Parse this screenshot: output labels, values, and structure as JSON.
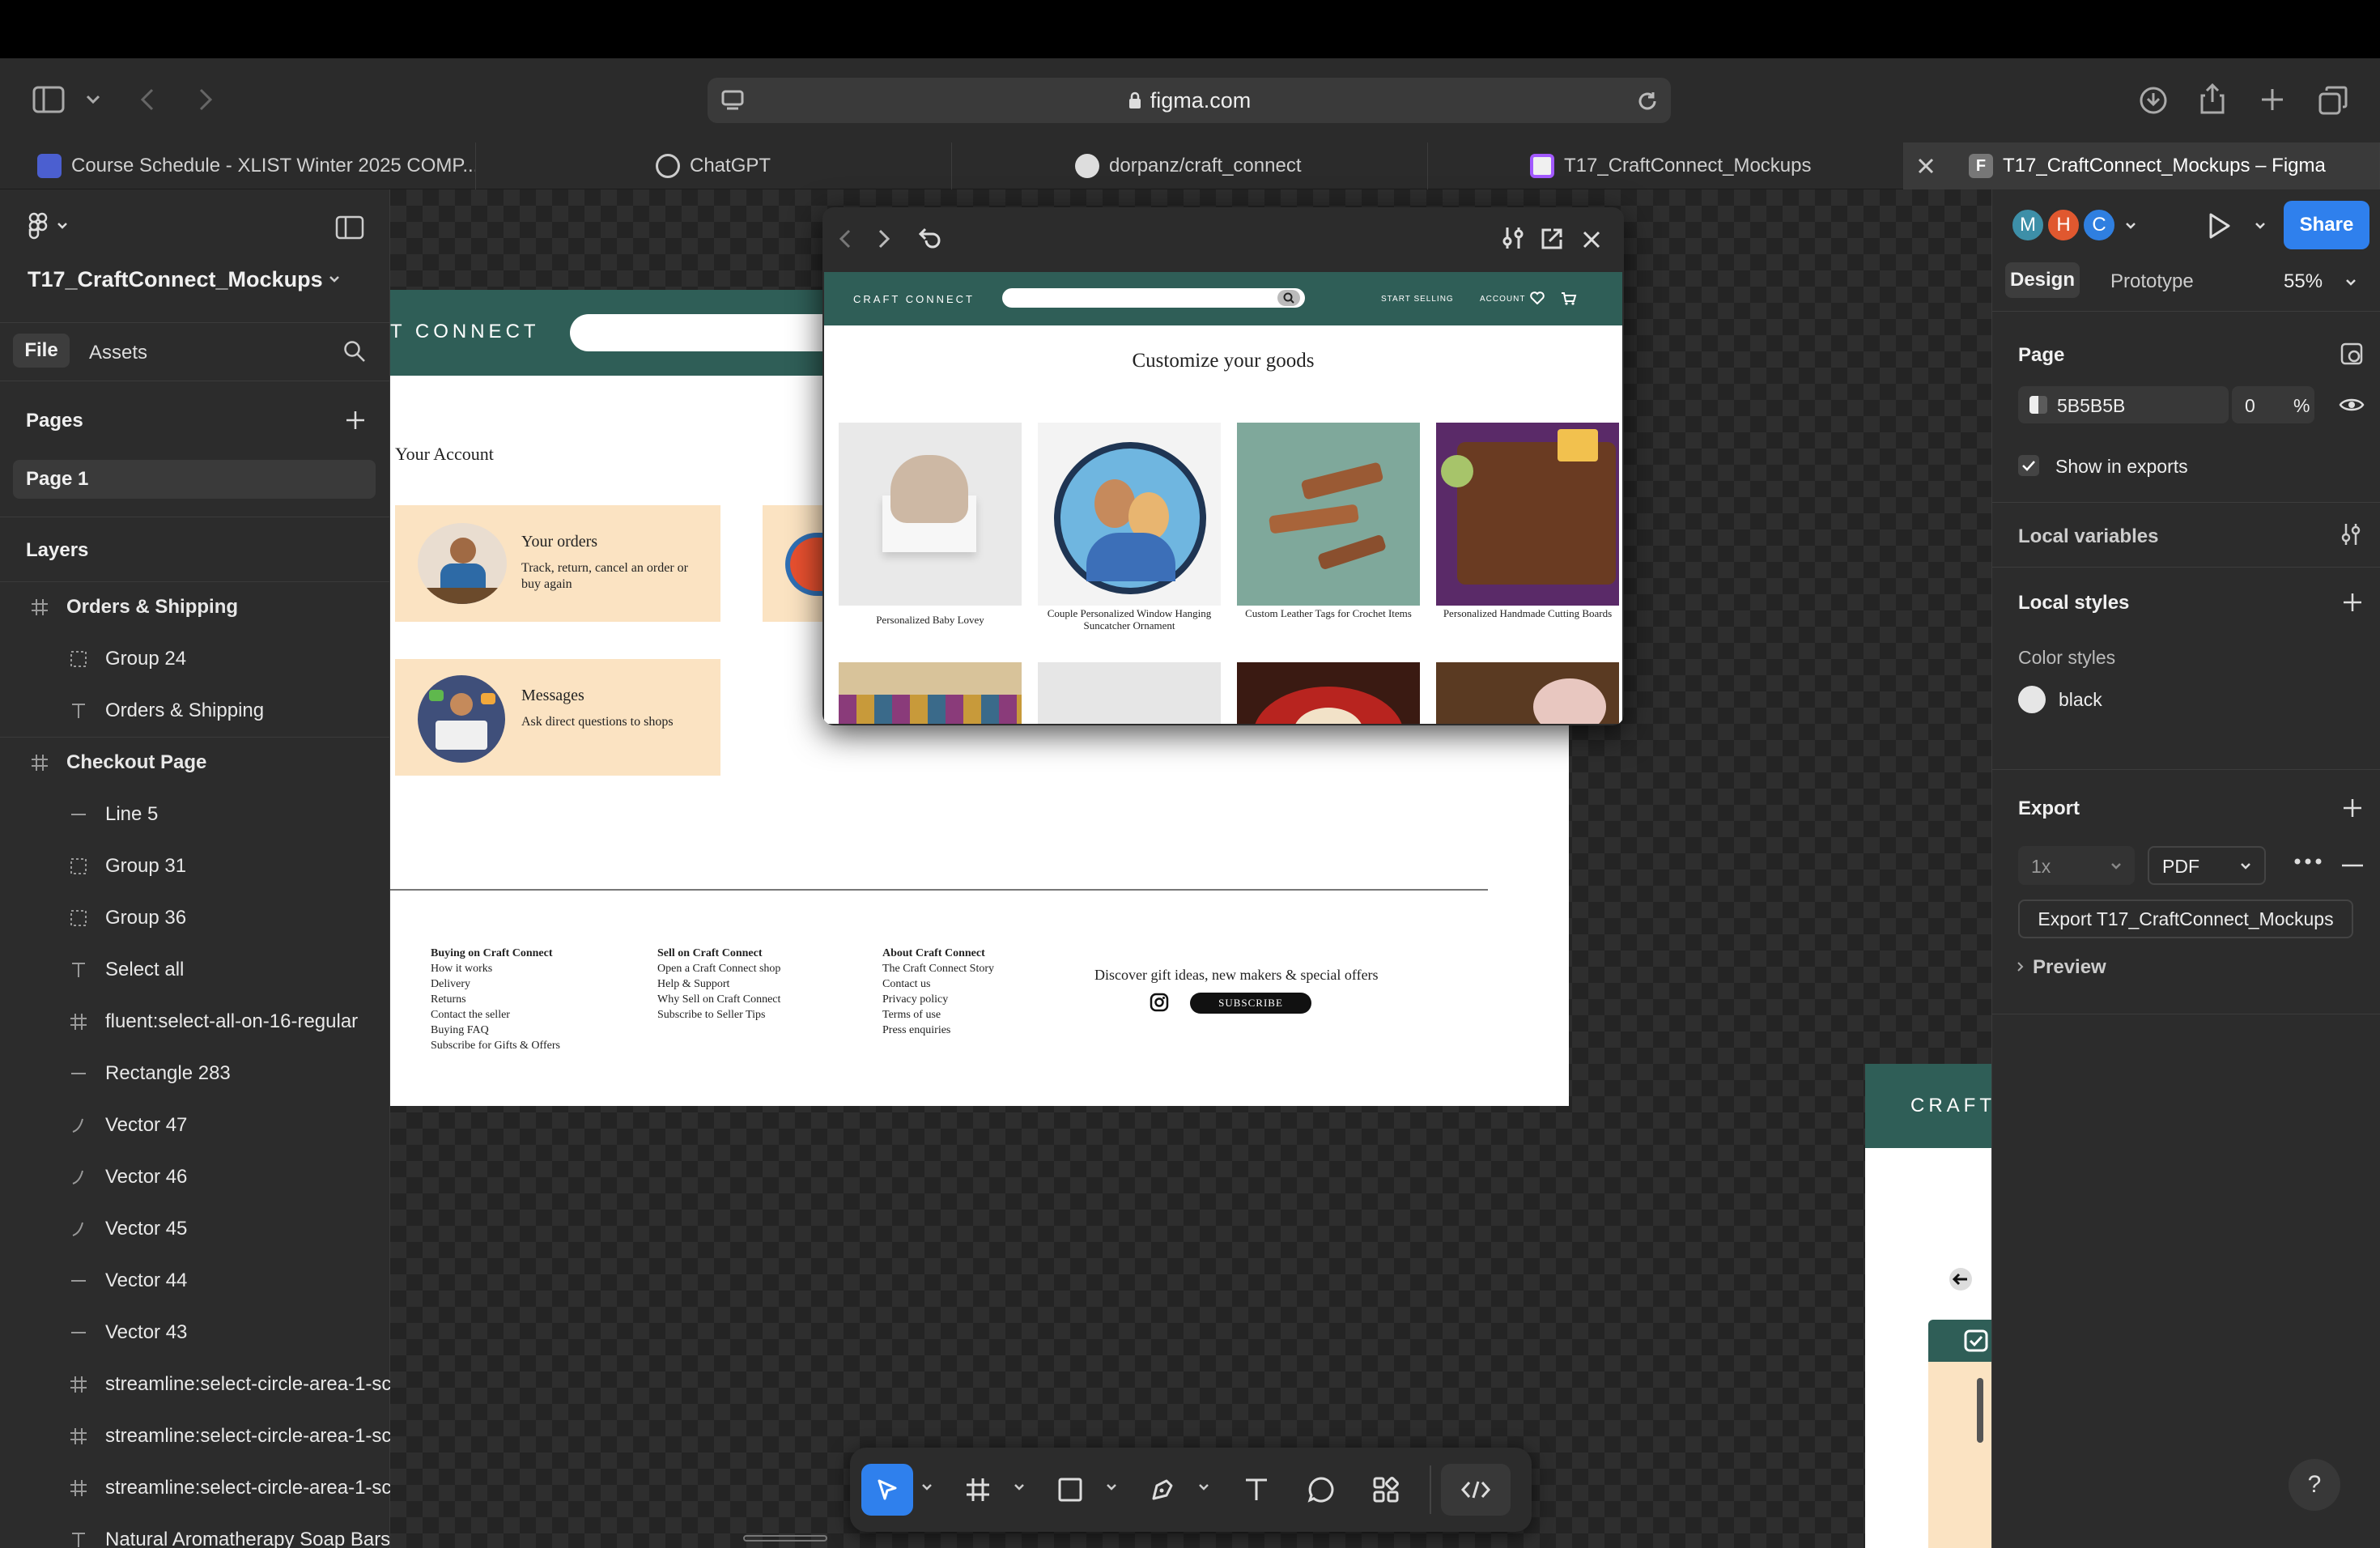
{
  "browser": {
    "url": "figma.com",
    "tabs": [
      {
        "label": "Course Schedule - XLIST Winter 2025 COMP..."
      },
      {
        "label": "ChatGPT"
      },
      {
        "label": "dorpanz/craft_connect"
      },
      {
        "label": "T17_CraftConnect_Mockups"
      },
      {
        "label": "T17_CraftConnect_Mockups – Figma"
      }
    ]
  },
  "left_panel": {
    "file_name": "T17_CraftConnect_Mockups",
    "tab_file": "File",
    "tab_assets": "Assets",
    "pages_title": "Pages",
    "page_1": "Page 1",
    "layers_title": "Layers",
    "layers": [
      {
        "name": "Orders & Shipping",
        "icon": "frame-icon",
        "bold": true
      },
      {
        "name": "Group 24",
        "icon": "group-icon"
      },
      {
        "name": "Orders & Shipping",
        "icon": "text-icon"
      },
      {
        "name": "Checkout Page",
        "icon": "frame-icon",
        "bold": true
      },
      {
        "name": "Line 5",
        "icon": "line-icon"
      },
      {
        "name": "Group 31",
        "icon": "group-icon"
      },
      {
        "name": "Group 36",
        "icon": "group-icon"
      },
      {
        "name": "Select all",
        "icon": "text-icon"
      },
      {
        "name": "fluent:select-all-on-16-regular",
        "icon": "frame-icon"
      },
      {
        "name": "Rectangle 283",
        "icon": "line-icon"
      },
      {
        "name": "Vector 47",
        "icon": "vector-icon"
      },
      {
        "name": "Vector 46",
        "icon": "vector-icon"
      },
      {
        "name": "Vector 45",
        "icon": "vector-icon"
      },
      {
        "name": "Vector 44",
        "icon": "line-icon"
      },
      {
        "name": "Vector 43",
        "icon": "line-icon"
      },
      {
        "name": "streamline:select-circle-area-1-sc",
        "icon": "frame-icon"
      },
      {
        "name": "streamline:select-circle-area-1-sc",
        "icon": "frame-icon"
      },
      {
        "name": "streamline:select-circle-area-1-sc",
        "icon": "frame-icon"
      },
      {
        "name": "Natural Aromatherapy Soap Bars",
        "icon": "text-icon"
      }
    ]
  },
  "right_panel": {
    "avatars": [
      "M",
      "H",
      "C"
    ],
    "avatar_colors": [
      "#3d8fa8",
      "#e0582f",
      "#2f7fe0"
    ],
    "share_label": "Share",
    "tab_design": "Design",
    "tab_prototype": "Prototype",
    "zoom": "55%",
    "page_title": "Page",
    "page_color": "5B5B5B",
    "page_opacity": "0",
    "percent": "%",
    "show_in_exports": "Show in exports",
    "local_variables": "Local variables",
    "local_styles": "Local styles",
    "color_styles": "Color styles",
    "color_style_name": "black",
    "export_title": "Export",
    "export_scale": "1x",
    "export_format": "PDF",
    "export_button": "Export T17_CraftConnect_Mockups",
    "preview": "Preview"
  },
  "canvas_frame": {
    "brand": "T CONNECT",
    "account_title": "Your Account",
    "cards": [
      {
        "title": "Your orders",
        "desc": "Track, return, cancel an order or buy again"
      },
      {
        "title": "Messages",
        "desc": "Ask direct questions to shops"
      }
    ],
    "footer_cols": [
      {
        "title": "Buying on Craft Connect",
        "items": [
          "How it works",
          "Delivery",
          "Returns",
          "Contact the seller",
          "Buying FAQ",
          "Subscribe for Gifts & Offers"
        ]
      },
      {
        "title": "Sell on Craft Connect",
        "items": [
          "Open a Craft Connect shop",
          "Help & Support",
          "Why Sell on Craft Connect",
          "Subscribe to Seller Tips"
        ]
      },
      {
        "title": "About Craft Connect",
        "items": [
          "The Craft Connect Story",
          "Contact us",
          "Privacy policy",
          "Terms of use",
          "Press enquiries"
        ]
      }
    ],
    "discover": "Discover gift ideas, new makers & special offers",
    "subscribe": "SUBSCRIBE"
  },
  "canvas_frame2": {
    "brand": "CRAFT C"
  },
  "prototype_window": {
    "brand": "CRAFT CONNECT",
    "nav_start_selling": "START SELLING",
    "nav_account": "ACCOUNT",
    "title": "Customize your goods",
    "products": [
      {
        "label": "Personalized Baby Lovey"
      },
      {
        "label": "Couple Personalized Window Hanging Suncatcher Ornament"
      },
      {
        "label": "Custom Leather Tags for Crochet Items"
      },
      {
        "label": "Personalized Handmade Cutting Boards"
      }
    ]
  },
  "colors": {
    "accent": "#2f6b62",
    "peach": "#fbe3c2",
    "share_blue": "#2f80ed"
  }
}
